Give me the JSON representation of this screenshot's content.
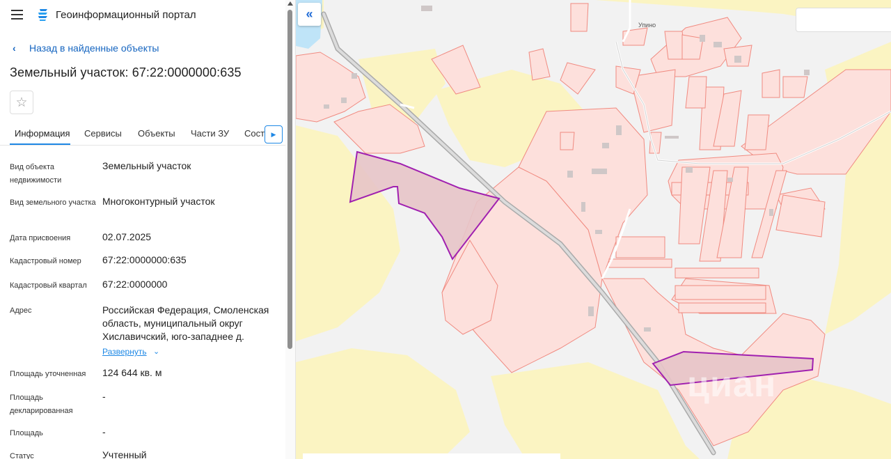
{
  "header": {
    "title": "Геоинформационный портал",
    "menu_icon": "menu-icon",
    "logo_icon": "portal-logo-icon"
  },
  "back_link": {
    "label": "Назад в найденные объекты"
  },
  "page_title": "Земельный участок: 67:22:0000000:635",
  "tabs": [
    {
      "label": "Информация",
      "active": true
    },
    {
      "label": "Сервисы"
    },
    {
      "label": "Объекты"
    },
    {
      "label": "Части ЗУ"
    },
    {
      "label": "Сост"
    }
  ],
  "properties": [
    {
      "label": "Вид объекта недвижимости",
      "value": "Земельный участок"
    },
    {
      "label": "Вид земельного участка",
      "value": "Многоконтурный участок"
    },
    {
      "label": "Дата присвоения",
      "value": "02.07.2025"
    },
    {
      "label": "Кадастровый номер",
      "value": "67:22:0000000:635"
    },
    {
      "label": "Кадастровый квартал",
      "value": "67:22:0000000"
    },
    {
      "label": "Адрес",
      "value": "Российская Федерация, Смоленская область, муниципальный округ Хиславичский, юго-западнее д.",
      "expand_label": "Развернуть"
    },
    {
      "label": "Площадь уточненная",
      "value": "124 644 кв. м"
    },
    {
      "label": "Площадь декларированная",
      "value": "-"
    },
    {
      "label": "Площадь",
      "value": "-"
    },
    {
      "label": "Статус",
      "value": "Учтенный"
    }
  ],
  "map": {
    "village_label": "Упино",
    "watermark": "циан",
    "search_placeholder": "",
    "colors": {
      "fields": "#fbf4c2",
      "parcels": "#fde0dc",
      "parcel_stroke": "#f08a80",
      "selected_fill": "#e7c4c8",
      "selected_stroke": "#a020b0",
      "road": "#b8b8b8"
    }
  }
}
